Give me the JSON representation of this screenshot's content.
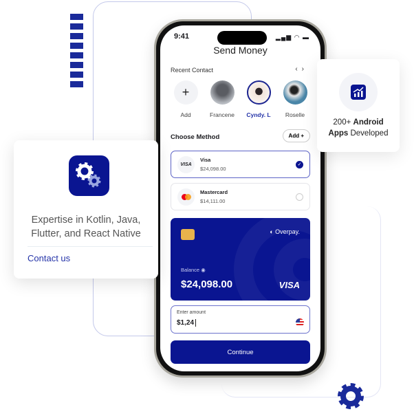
{
  "phone": {
    "status_time": "9:41",
    "status_icons": "signal-wifi-battery-icons",
    "title": "Send Money",
    "recent_contact_label": "Recent Contact",
    "prev_icon": "chevron-left-icon",
    "next_icon": "chevron-right-icon",
    "contacts": [
      {
        "label": "Add",
        "icon": "plus-icon"
      },
      {
        "label": "Francene"
      },
      {
        "label": "Cyndy. L",
        "selected": true
      },
      {
        "label": "Roselle"
      }
    ],
    "choose_method_label": "Choose Method",
    "add_method_label": "Add +",
    "methods": [
      {
        "logo": "VISA",
        "name": "Visa",
        "balance": "$24,098.00",
        "selected": true
      },
      {
        "logo": "mastercard-icon",
        "name": "Mastercard",
        "balance": "$14,111.00",
        "selected": false
      }
    ],
    "card": {
      "brand": "Overpay.",
      "balance_label": "Balance",
      "balance": "$24,098.00",
      "network": "VISA",
      "color": "#0a1591"
    },
    "amount": {
      "label": "Enter amount",
      "value": "$1,24",
      "currency_icon": "us-flag-icon"
    },
    "continue_label": "Continue"
  },
  "left_card": {
    "icon": "gears-icon",
    "text_line1": "Expertise in Kotlin, Java,",
    "text_line2": "Flutter, and React Native",
    "link": "Contact us"
  },
  "right_card": {
    "icon": "chart-growth-icon",
    "count": "200+",
    "bold": "Android",
    "bold2": "Apps",
    "rest": "Developed"
  },
  "accent_color": "#0a1591"
}
